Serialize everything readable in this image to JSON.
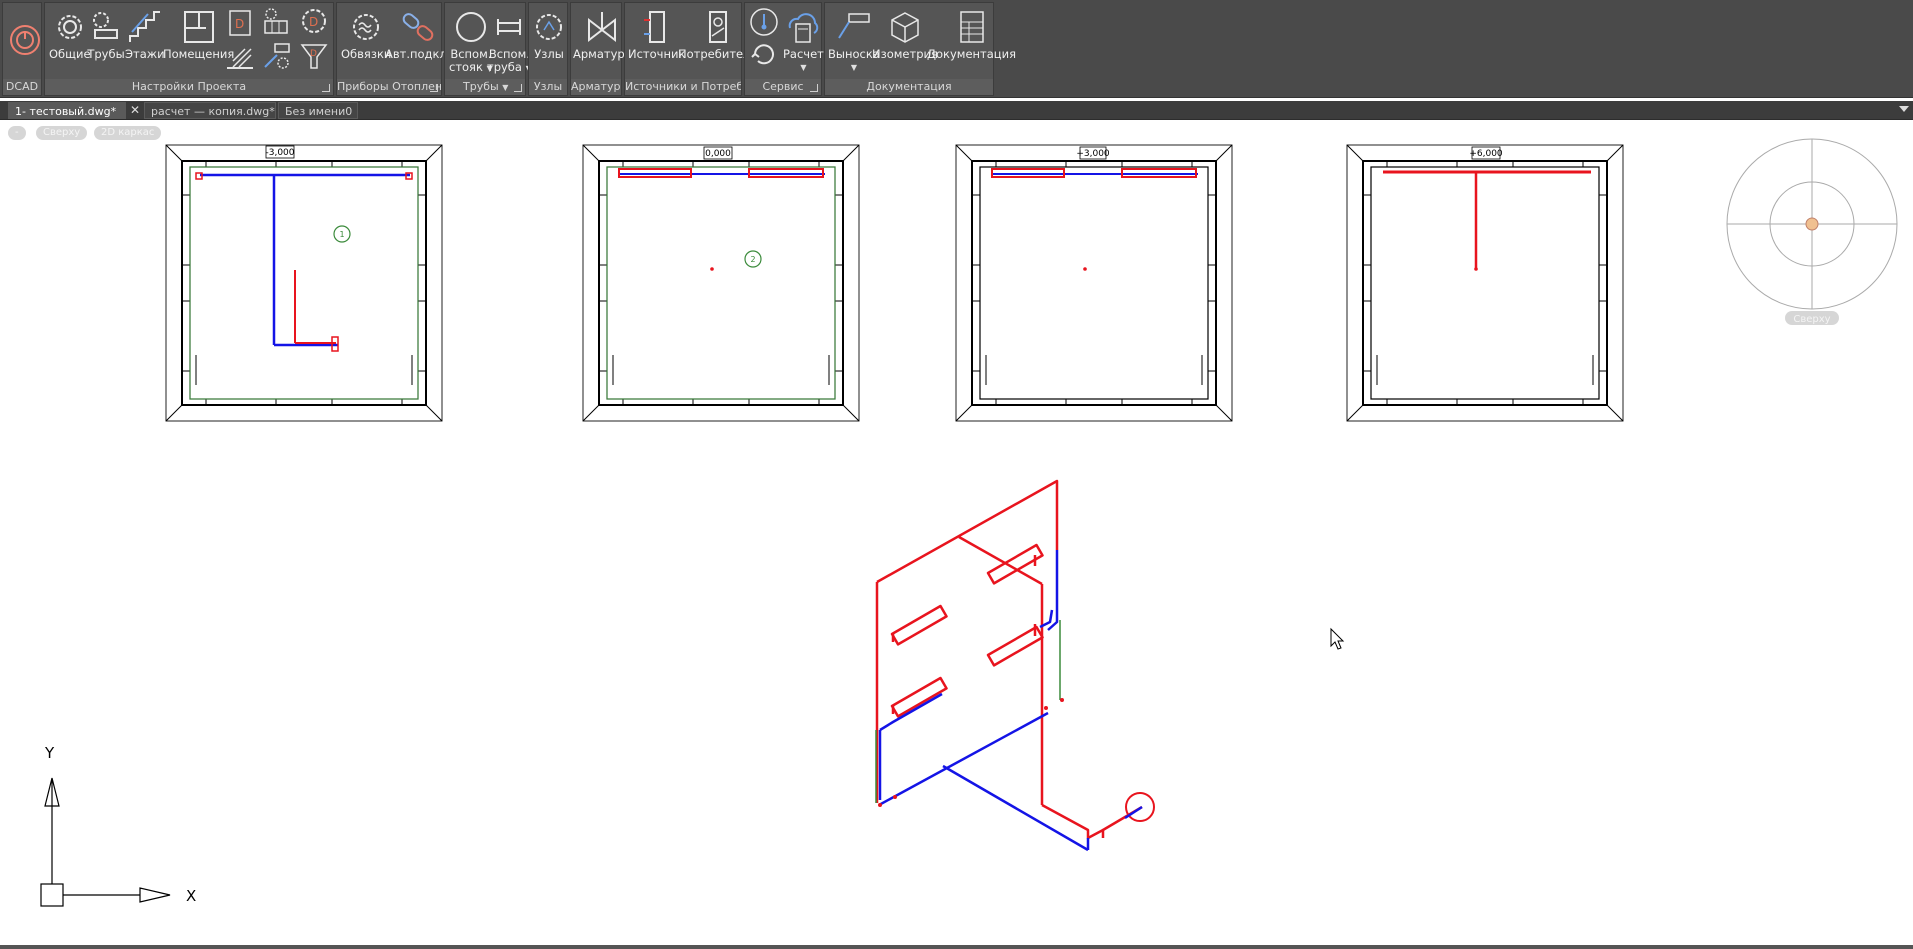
{
  "ribbon": {
    "dcad": {
      "title": "DCAD"
    },
    "project_settings": {
      "title": "Настройки Проекта",
      "tools": [
        "Общие",
        "Трубы",
        "Этажи",
        "Помещения"
      ]
    },
    "heating_devices": {
      "title": "Приборы Отоплен...",
      "tools": [
        "Обвязки",
        "Авт.подкл."
      ]
    },
    "pipes": {
      "title": "Трубы",
      "tool1_line1": "Вспом.",
      "tool1_line2": "стояк",
      "tool2_line1": "Вспом.",
      "tool2_line2": "труба"
    },
    "nodes": {
      "title": "Узлы",
      "tool": "Узлы"
    },
    "fittings": {
      "title": "Арматура",
      "tool": "Арматура"
    },
    "sources": {
      "title": "Источники и Потребите...",
      "tools": [
        "Источник",
        "Потребитель"
      ]
    },
    "service": {
      "title": "Сервис",
      "tool": "Расчет"
    },
    "documentation": {
      "title": "Документация",
      "tools": [
        "Выноска",
        "Изометрия",
        "Документация"
      ]
    }
  },
  "tabs": [
    {
      "label": "1- тестовый.dwg*",
      "active": true
    },
    {
      "label": "расчет — копия.dwg*",
      "active": false
    },
    {
      "label": "Без имени0",
      "active": false
    }
  ],
  "viewport": {
    "controls": [
      "-",
      "Сверху",
      "2D каркас"
    ],
    "viewcube_label": "Сверху"
  },
  "drawing": {
    "floor_levels": [
      "-3,000",
      "0,000",
      "+3,000",
      "+6,000"
    ],
    "room_markers": [
      "1",
      "2"
    ],
    "ucs_labels": {
      "x": "X",
      "y": "Y"
    }
  },
  "colors": {
    "ribbon_bg": "#4a4a4a",
    "supply_pipe": "#e8141e",
    "return_pipe": "#1414e6",
    "wall_green": "#3a8a3a",
    "canvas_bg": "#ffffff"
  }
}
